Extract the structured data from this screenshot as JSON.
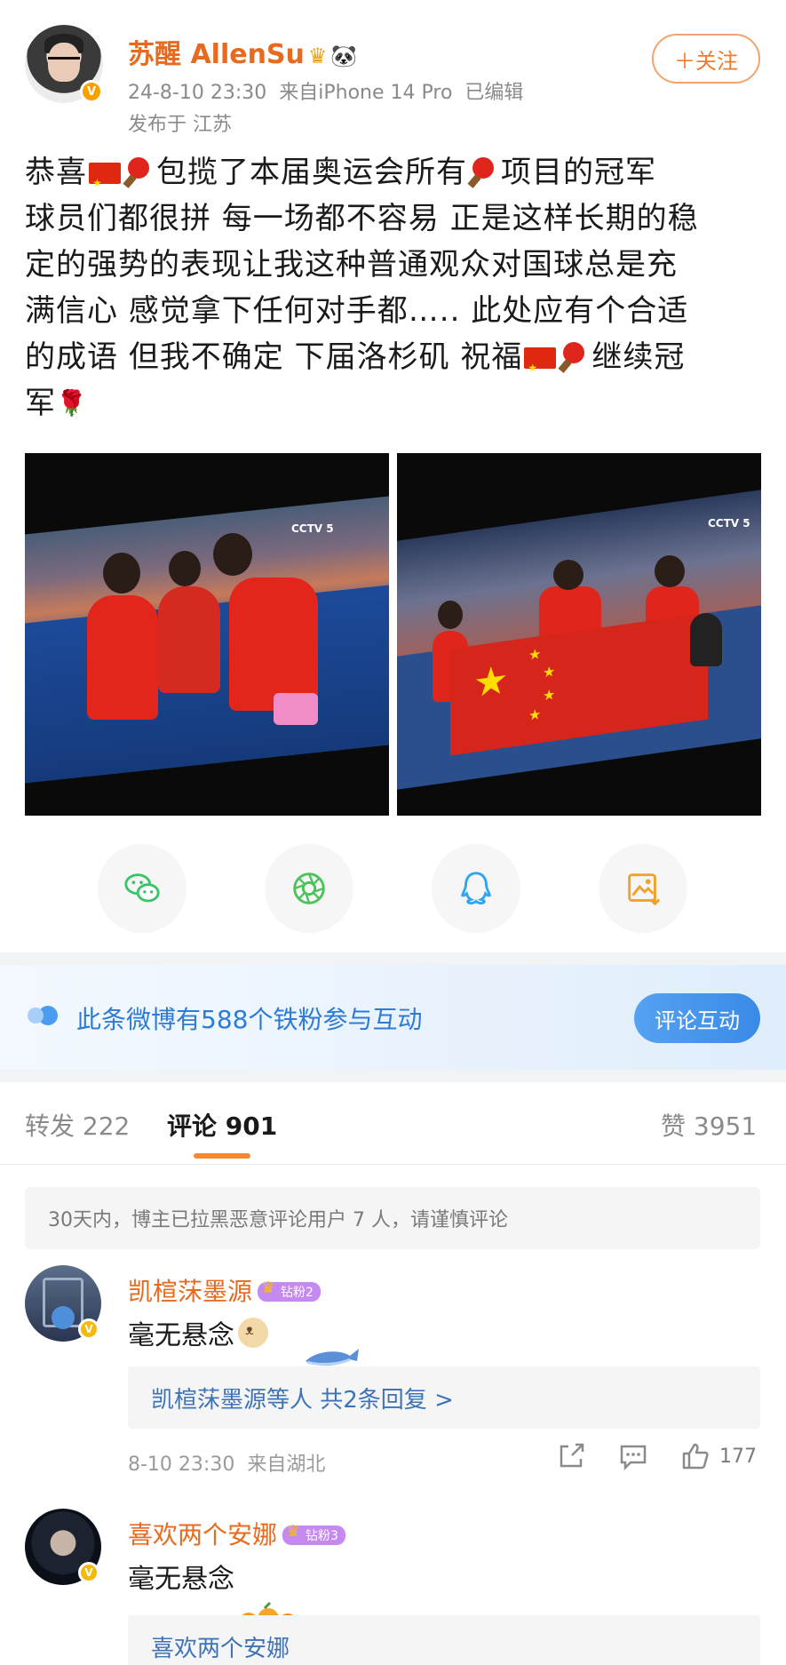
{
  "post": {
    "author": {
      "name": "苏醒 AllenSu",
      "verified_badge": "V",
      "timestamp": "24-8-10 23:30",
      "source": "来自iPhone 14 Pro",
      "edited": "已编辑",
      "location": "发布于 江苏"
    },
    "follow_label": "＋关注",
    "lines": [
      {
        "segments": [
          {
            "t": "text",
            "v": "恭喜"
          },
          {
            "t": "flag"
          },
          {
            "t": "paddle"
          },
          {
            "t": "text",
            "v": "包揽了本届奥运会所有"
          },
          {
            "t": "paddle"
          },
          {
            "t": "text",
            "v": "项目的冠军"
          }
        ]
      },
      {
        "segments": [
          {
            "t": "text",
            "v": "球员们都很拼 每一场都不容易 正是这样长期的稳"
          }
        ]
      },
      {
        "segments": [
          {
            "t": "text",
            "v": "定的强势的表现让我这种普通观众对国球总是充"
          }
        ]
      },
      {
        "segments": [
          {
            "t": "text",
            "v": "满信心 感觉拿下任何对手都….. 此处应有个合适"
          }
        ]
      },
      {
        "segments": [
          {
            "t": "text",
            "v": "的成语 但我不确定 下届洛杉矶 祝福"
          },
          {
            "t": "flag"
          },
          {
            "t": "paddle"
          },
          {
            "t": "text",
            "v": "继续冠"
          }
        ]
      },
      {
        "segments": [
          {
            "t": "text",
            "v": "军"
          },
          {
            "t": "rose"
          }
        ]
      }
    ],
    "photo_overlays": {
      "photo1_tv": "CCTV 5",
      "photo2_tv": "CCTV 5"
    }
  },
  "share_icons": [
    "wechat-icon",
    "moments-icon",
    "qq-icon",
    "save-image-icon"
  ],
  "fan_bar": {
    "text": "此条微博有588个铁粉参与互动",
    "button": "评论互动"
  },
  "tabs": {
    "repost": "转发 222",
    "comments": "评论 901",
    "likes": "赞 3951"
  },
  "notice": "30天内，博主已拉黑恶意评论用户 7 人，请谨慎评论",
  "comments": [
    {
      "name": "凯楦莯墨源",
      "badge": "钻粉2",
      "text": "毫无悬念",
      "reply_summary": "凯楦莯墨源等人  共2条回复 >",
      "time": "8-10 23:30",
      "location": "来自湖北",
      "likes": "177"
    },
    {
      "name": "喜欢两个安娜",
      "badge": "钻粉3",
      "text": "毫无悬念",
      "reply_summary": "喜欢两个安娜"
    }
  ],
  "colors": {
    "username": "#e86a1e",
    "link_blue": "#3f73b8",
    "fan_blue": "#2e7bd6",
    "tab_accent": "#f08a34"
  }
}
